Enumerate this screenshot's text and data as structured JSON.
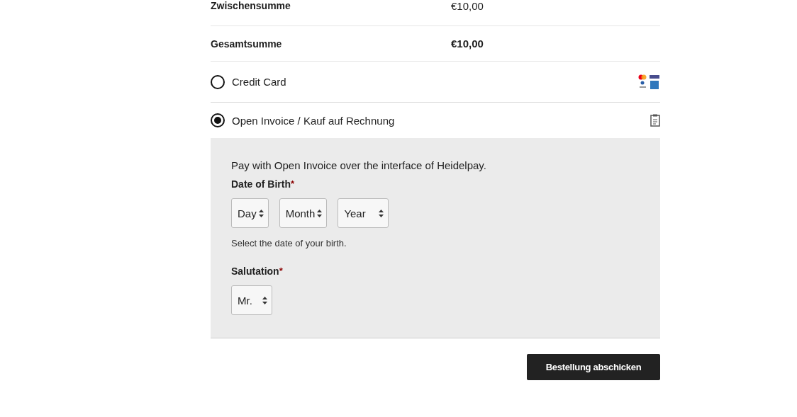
{
  "totals": [
    {
      "label": "Zwischensumme",
      "value": "€10,00",
      "emphasis": false
    },
    {
      "label": "Gesamtsumme",
      "value": "€10,00",
      "emphasis": true
    }
  ],
  "payment_methods": [
    {
      "label": "Credit Card",
      "selected": false,
      "kind": "cards"
    },
    {
      "label": "Open Invoice / Kauf auf Rechnung",
      "selected": true,
      "kind": "invoice"
    }
  ],
  "invoice_panel": {
    "description": "Pay with Open Invoice over the interface of Heidelpay.",
    "birth_date": {
      "label": "Date of Birth",
      "required_mark": "*",
      "selects": [
        "Day",
        "Month",
        "Year"
      ],
      "hint": "Select the date of your birth."
    },
    "salutation": {
      "label": "Salutation",
      "required_mark": "*",
      "value": "Mr."
    }
  },
  "submit_button": "Bestellung abschicken"
}
